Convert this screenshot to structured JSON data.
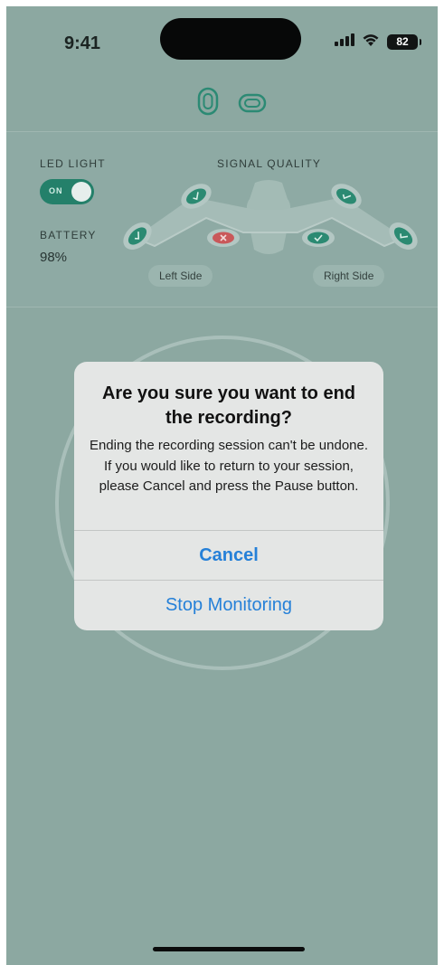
{
  "status_bar": {
    "time": "9:41",
    "battery_level": "82",
    "icons": [
      "signal-icon",
      "wifi-icon",
      "battery-icon"
    ]
  },
  "device_icons": [
    "earbud-vertical-icon",
    "earbud-horizontal-icon"
  ],
  "panel": {
    "led_label": "LED LIGHT",
    "led_toggle_label": "ON",
    "led_on": true,
    "battery_label": "BATTERY",
    "battery_value": "98%",
    "signal_label": "SIGNAL QUALITY",
    "left_side_label": "Left Side",
    "right_side_label": "Right Side",
    "sensors": [
      {
        "side": "left",
        "status": "ok"
      },
      {
        "side": "left",
        "status": "ok"
      },
      {
        "side": "left",
        "status": "error"
      },
      {
        "side": "right",
        "status": "ok"
      },
      {
        "side": "right",
        "status": "ok"
      },
      {
        "side": "right",
        "status": "ok"
      }
    ]
  },
  "dialog": {
    "title": "Are you sure you want to end the recording?",
    "message": "Ending the recording session can't be undone. If you would like to return to your session, please Cancel and press the Pause button.",
    "cancel_label": "Cancel",
    "stop_label": "Stop Monitoring"
  },
  "colors": {
    "background": "#8ca8a1",
    "accent_green": "#24806a",
    "error_red": "#c9585a",
    "dialog_bg": "#e4e6e5",
    "ios_blue": "#2580d8"
  }
}
